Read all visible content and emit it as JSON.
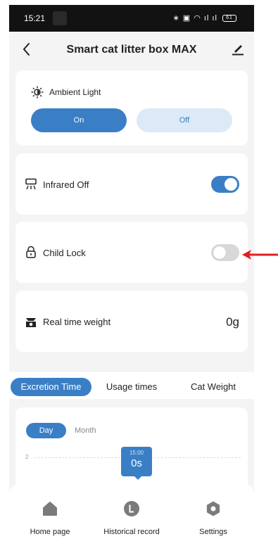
{
  "status_bar": {
    "time": "15:21",
    "icons_text": "∗ ▣ ◠ ıl ıl",
    "battery": "61"
  },
  "header": {
    "title": "Smart cat litter box MAX",
    "back_icon": "chevron-left-icon",
    "edit_icon": "pencil-icon"
  },
  "ambient_light": {
    "label": "Ambient Light",
    "on_label": "On",
    "off_label": "Off",
    "selected": "On"
  },
  "infrared": {
    "label": "Infrared Off",
    "enabled": true
  },
  "child_lock": {
    "label": "Child Lock",
    "enabled": false
  },
  "weight": {
    "label": "Real time weight",
    "value": "0g"
  },
  "tabs": [
    {
      "label": "Excretion Time",
      "active": true
    },
    {
      "label": "Usage times",
      "active": false
    },
    {
      "label": "Cat Weight",
      "active": false
    }
  ],
  "chart": {
    "period_options": [
      "Day",
      "Month"
    ],
    "selected_period": "Day",
    "y_tick": "2",
    "tooltip_time": "15:00",
    "tooltip_value": "0s"
  },
  "bottom_nav": [
    {
      "label": "Home page",
      "icon": "home-icon"
    },
    {
      "label": "Historical record",
      "icon": "history-icon"
    },
    {
      "label": "Settings",
      "icon": "gear-icon"
    }
  ],
  "colors": {
    "accent": "#3a7fc6",
    "accent_light": "#dce9f6",
    "arrow": "#e02020"
  }
}
